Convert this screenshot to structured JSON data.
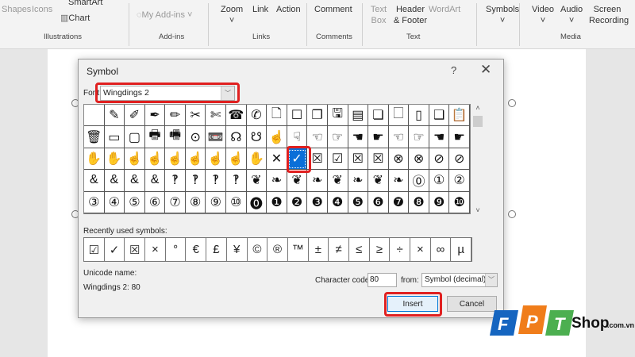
{
  "ribbon": {
    "items": [
      {
        "label": "Shapes",
        "dim": true
      },
      {
        "label": "Icons",
        "dim": true
      },
      {
        "label": "SmartArt"
      },
      {
        "label": "Chart"
      },
      {
        "label": "My Add-ins",
        "dim": true
      },
      {
        "label": "Zoom"
      },
      {
        "label": "Link"
      },
      {
        "label": "Action"
      },
      {
        "label": "Comment"
      },
      {
        "label": "Text Box",
        "dim": true
      },
      {
        "label": "Header & Footer"
      },
      {
        "label": "WordArt",
        "dim": true
      },
      {
        "label": "Symbols"
      },
      {
        "label": "Video"
      },
      {
        "label": "Audio"
      },
      {
        "label": "Screen Recording"
      }
    ],
    "groups": [
      "Illustrations",
      "Add-ins",
      "Links",
      "Comments",
      "Text",
      "Media"
    ]
  },
  "dialog": {
    "title": "Symbol",
    "help": "?",
    "close": "✕",
    "font_label": "Font:",
    "font_value": "Wingdings 2",
    "grid": [
      [
        "",
        "✎",
        "✐",
        "✒",
        "✏",
        "✂",
        "✄",
        "☎",
        "✆",
        "🗋",
        "☐",
        "❐",
        "🖫",
        "▤",
        "❏",
        "🗌",
        "▯",
        "❑",
        "📋"
      ],
      [
        "🗑",
        "▭",
        "▢",
        "🖶",
        "🖷",
        "⊙",
        "📼",
        "☊",
        "☋",
        "☝",
        "☟",
        "☜",
        "☞",
        "☚",
        "☛",
        "☜",
        "☞",
        "☚",
        "☛"
      ],
      [
        "✋",
        "✋",
        "☝",
        "☝",
        "☝",
        "☝",
        "☝",
        "☝",
        "✋",
        "✕",
        "✓",
        "☒",
        "☑",
        "☒",
        "☒",
        "⊗",
        "⊗",
        "⊘",
        "⊘"
      ],
      [
        "&",
        "&",
        "&",
        "&",
        "‽",
        "‽",
        "‽",
        "‽",
        "❦",
        "❧",
        "❦",
        "❧",
        "❦",
        "❧",
        "❦",
        "❧",
        "⓪",
        "①",
        "②"
      ],
      [
        "③",
        "④",
        "⑤",
        "⑥",
        "⑦",
        "⑧",
        "⑨",
        "⑩",
        "⓿",
        "❶",
        "❷",
        "❸",
        "❹",
        "❺",
        "❻",
        "❼",
        "❽",
        "❾",
        "❿"
      ]
    ],
    "selected": [
      2,
      10
    ],
    "scroll_up": "˄",
    "scroll_down": "˅",
    "recent_label": "Recently used symbols:",
    "recent": [
      "☑",
      "✓",
      "☒",
      "×",
      "°",
      "€",
      "£",
      "¥",
      "©",
      "®",
      "™",
      "±",
      "≠",
      "≤",
      "≥",
      "÷",
      "×",
      "∞",
      "µ"
    ],
    "unicode_name_label": "Unicode name:",
    "unicode_name_value": "Wingdings 2: 80",
    "char_code_label": "Character code:",
    "char_code_value": "80",
    "from_label": "from:",
    "from_value": "Symbol (decimal)",
    "insert_label": "Insert",
    "cancel_label": "Cancel"
  },
  "logo": {
    "text": "FPT",
    "shop": "Shop",
    ".com.vn": ".com.vn"
  },
  "colors": {
    "highlight": "#e02020",
    "selected": "#0a6fd8",
    "fpt_blue": "#1565c0",
    "fpt_orange": "#f07d1a",
    "fpt_green": "#4caf50"
  }
}
